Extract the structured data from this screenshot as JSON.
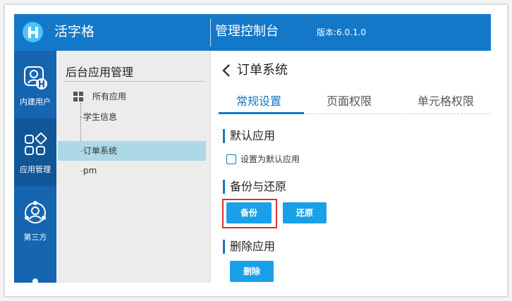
{
  "header": {
    "brand": "活字格",
    "console_title": "管理控制台",
    "version": "版本:6.0.1.0",
    "logo_letter": "H"
  },
  "nav": {
    "items": [
      {
        "label": "内建用户",
        "icon": "user-badge-icon"
      },
      {
        "label": "应用管理",
        "icon": "apps-grid-icon"
      },
      {
        "label": "第三方",
        "icon": "third-party-icon"
      }
    ],
    "active": "应用管理"
  },
  "tree": {
    "title": "后台应用管理",
    "root_label": "所有应用",
    "items": [
      "学生信息",
      "订单系统",
      "pm"
    ],
    "selected": "订单系统"
  },
  "main": {
    "back_icon": "chevron-left-icon",
    "title": "订单系统",
    "tabs": [
      "常规设置",
      "页面权限",
      "单元格权限"
    ],
    "active_tab": "常规设置",
    "sections": {
      "default_app": {
        "title": "默认应用",
        "checkbox_label": "设置为默认应用",
        "checked": false
      },
      "backup_restore": {
        "title": "备份与还原",
        "backup_button": "备份",
        "restore_button": "还原"
      },
      "delete_app": {
        "title": "删除应用",
        "delete_button": "删除"
      }
    }
  },
  "colors": {
    "header_bg": "#1478c8",
    "nav_bg": "#1565b0",
    "accent": "#1478c8",
    "button": "#1aa0e8",
    "selected_row": "#add8e6",
    "highlight": "#d9302e"
  }
}
